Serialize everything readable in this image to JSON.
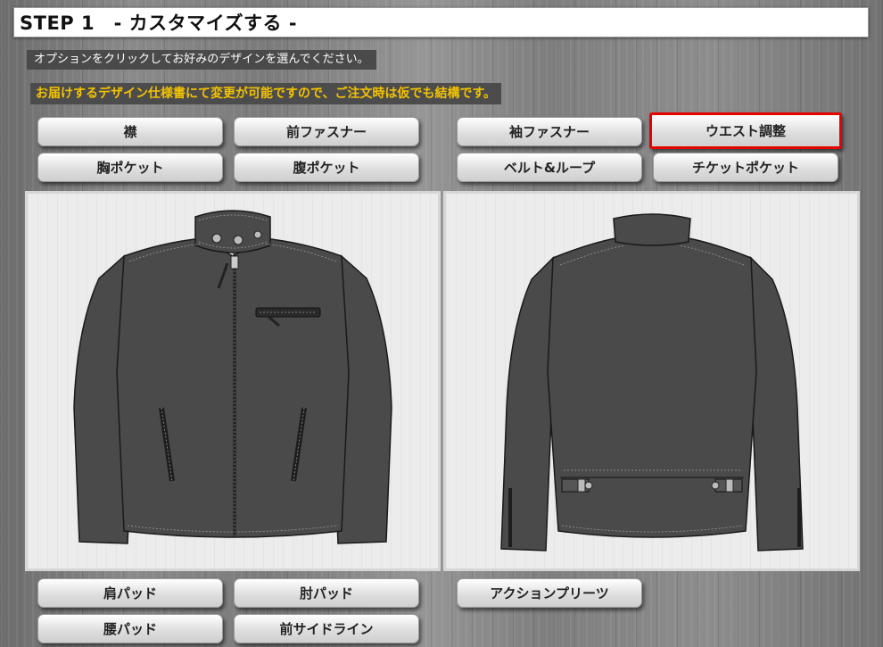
{
  "header": {
    "title": "STEP 1　- カスタマイズする -"
  },
  "notes": {
    "instruction": "オプションをクリックしてお好みのデザインを選んでください。",
    "notice": "お届けするデザイン仕様書にて変更が可能ですので、ご注文時は仮でも結構です。"
  },
  "options_top": {
    "collar": "襟",
    "front_fastener": "前ファスナー",
    "sleeve_fastener": "袖ファスナー",
    "waist_adjust": "ウエスト調整",
    "chest_pocket": "胸ポケット",
    "belly_pocket": "腹ポケット",
    "belt_loop": "ベルト&ループ",
    "ticket_pocket": "チケットポケット"
  },
  "options_bottom": {
    "shoulder_pad": "肩パッド",
    "elbow_pad": "肘パッド",
    "action_pleats": "アクションプリーツ",
    "waist_pad": "腰パッド",
    "front_side_line": "前サイドライン"
  },
  "selected_option": "ウエスト調整",
  "colors": {
    "selected_border": "#e60000",
    "notice_text": "#f2c200",
    "jacket": "#4a4a4a"
  }
}
